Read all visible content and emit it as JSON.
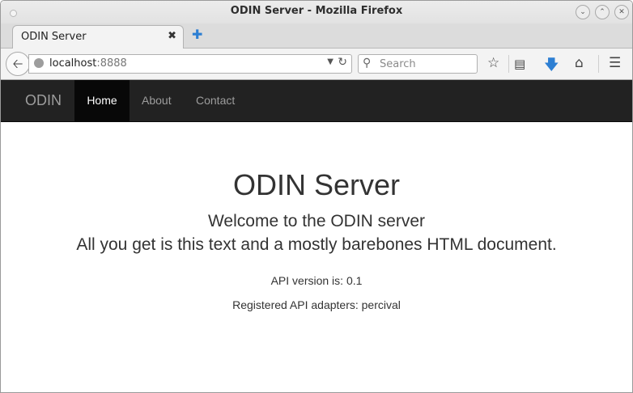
{
  "window": {
    "title": "ODIN Server - Mozilla Firefox"
  },
  "tabs": [
    {
      "label": "ODIN Server",
      "active": true
    }
  ],
  "toolbar": {
    "url_host": "localhost",
    "url_port": ":8888",
    "search_placeholder": "Search"
  },
  "site": {
    "brand": "ODIN",
    "nav": [
      {
        "label": "Home",
        "active": true
      },
      {
        "label": "About",
        "active": false
      },
      {
        "label": "Contact",
        "active": false
      }
    ],
    "heading": "ODIN Server",
    "lead_line1": "Welcome to the ODIN server",
    "lead_line2": "All you get is this text and a mostly barebones HTML document.",
    "api_version": "API version is: 0.1",
    "adapters": "Registered API adapters: percival"
  },
  "colors": {
    "navbar_bg": "#222222",
    "navbar_active_bg": "#080808",
    "download_icon": "#2d7fd3"
  }
}
